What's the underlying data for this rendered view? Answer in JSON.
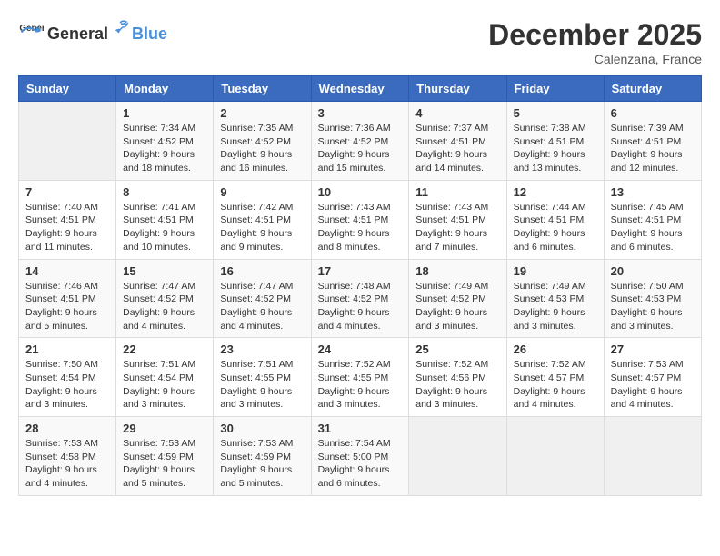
{
  "header": {
    "logo_general": "General",
    "logo_blue": "Blue",
    "month": "December 2025",
    "location": "Calenzana, France"
  },
  "days_of_week": [
    "Sunday",
    "Monday",
    "Tuesday",
    "Wednesday",
    "Thursday",
    "Friday",
    "Saturday"
  ],
  "weeks": [
    [
      {
        "day": "",
        "info": ""
      },
      {
        "day": "1",
        "info": "Sunrise: 7:34 AM\nSunset: 4:52 PM\nDaylight: 9 hours\nand 18 minutes."
      },
      {
        "day": "2",
        "info": "Sunrise: 7:35 AM\nSunset: 4:52 PM\nDaylight: 9 hours\nand 16 minutes."
      },
      {
        "day": "3",
        "info": "Sunrise: 7:36 AM\nSunset: 4:52 PM\nDaylight: 9 hours\nand 15 minutes."
      },
      {
        "day": "4",
        "info": "Sunrise: 7:37 AM\nSunset: 4:51 PM\nDaylight: 9 hours\nand 14 minutes."
      },
      {
        "day": "5",
        "info": "Sunrise: 7:38 AM\nSunset: 4:51 PM\nDaylight: 9 hours\nand 13 minutes."
      },
      {
        "day": "6",
        "info": "Sunrise: 7:39 AM\nSunset: 4:51 PM\nDaylight: 9 hours\nand 12 minutes."
      }
    ],
    [
      {
        "day": "7",
        "info": "Sunrise: 7:40 AM\nSunset: 4:51 PM\nDaylight: 9 hours\nand 11 minutes."
      },
      {
        "day": "8",
        "info": "Sunrise: 7:41 AM\nSunset: 4:51 PM\nDaylight: 9 hours\nand 10 minutes."
      },
      {
        "day": "9",
        "info": "Sunrise: 7:42 AM\nSunset: 4:51 PM\nDaylight: 9 hours\nand 9 minutes."
      },
      {
        "day": "10",
        "info": "Sunrise: 7:43 AM\nSunset: 4:51 PM\nDaylight: 9 hours\nand 8 minutes."
      },
      {
        "day": "11",
        "info": "Sunrise: 7:43 AM\nSunset: 4:51 PM\nDaylight: 9 hours\nand 7 minutes."
      },
      {
        "day": "12",
        "info": "Sunrise: 7:44 AM\nSunset: 4:51 PM\nDaylight: 9 hours\nand 6 minutes."
      },
      {
        "day": "13",
        "info": "Sunrise: 7:45 AM\nSunset: 4:51 PM\nDaylight: 9 hours\nand 6 minutes."
      }
    ],
    [
      {
        "day": "14",
        "info": "Sunrise: 7:46 AM\nSunset: 4:51 PM\nDaylight: 9 hours\nand 5 minutes."
      },
      {
        "day": "15",
        "info": "Sunrise: 7:47 AM\nSunset: 4:52 PM\nDaylight: 9 hours\nand 4 minutes."
      },
      {
        "day": "16",
        "info": "Sunrise: 7:47 AM\nSunset: 4:52 PM\nDaylight: 9 hours\nand 4 minutes."
      },
      {
        "day": "17",
        "info": "Sunrise: 7:48 AM\nSunset: 4:52 PM\nDaylight: 9 hours\nand 4 minutes."
      },
      {
        "day": "18",
        "info": "Sunrise: 7:49 AM\nSunset: 4:52 PM\nDaylight: 9 hours\nand 3 minutes."
      },
      {
        "day": "19",
        "info": "Sunrise: 7:49 AM\nSunset: 4:53 PM\nDaylight: 9 hours\nand 3 minutes."
      },
      {
        "day": "20",
        "info": "Sunrise: 7:50 AM\nSunset: 4:53 PM\nDaylight: 9 hours\nand 3 minutes."
      }
    ],
    [
      {
        "day": "21",
        "info": "Sunrise: 7:50 AM\nSunset: 4:54 PM\nDaylight: 9 hours\nand 3 minutes."
      },
      {
        "day": "22",
        "info": "Sunrise: 7:51 AM\nSunset: 4:54 PM\nDaylight: 9 hours\nand 3 minutes."
      },
      {
        "day": "23",
        "info": "Sunrise: 7:51 AM\nSunset: 4:55 PM\nDaylight: 9 hours\nand 3 minutes."
      },
      {
        "day": "24",
        "info": "Sunrise: 7:52 AM\nSunset: 4:55 PM\nDaylight: 9 hours\nand 3 minutes."
      },
      {
        "day": "25",
        "info": "Sunrise: 7:52 AM\nSunset: 4:56 PM\nDaylight: 9 hours\nand 3 minutes."
      },
      {
        "day": "26",
        "info": "Sunrise: 7:52 AM\nSunset: 4:57 PM\nDaylight: 9 hours\nand 4 minutes."
      },
      {
        "day": "27",
        "info": "Sunrise: 7:53 AM\nSunset: 4:57 PM\nDaylight: 9 hours\nand 4 minutes."
      }
    ],
    [
      {
        "day": "28",
        "info": "Sunrise: 7:53 AM\nSunset: 4:58 PM\nDaylight: 9 hours\nand 4 minutes."
      },
      {
        "day": "29",
        "info": "Sunrise: 7:53 AM\nSunset: 4:59 PM\nDaylight: 9 hours\nand 5 minutes."
      },
      {
        "day": "30",
        "info": "Sunrise: 7:53 AM\nSunset: 4:59 PM\nDaylight: 9 hours\nand 5 minutes."
      },
      {
        "day": "31",
        "info": "Sunrise: 7:54 AM\nSunset: 5:00 PM\nDaylight: 9 hours\nand 6 minutes."
      },
      {
        "day": "",
        "info": ""
      },
      {
        "day": "",
        "info": ""
      },
      {
        "day": "",
        "info": ""
      }
    ]
  ]
}
